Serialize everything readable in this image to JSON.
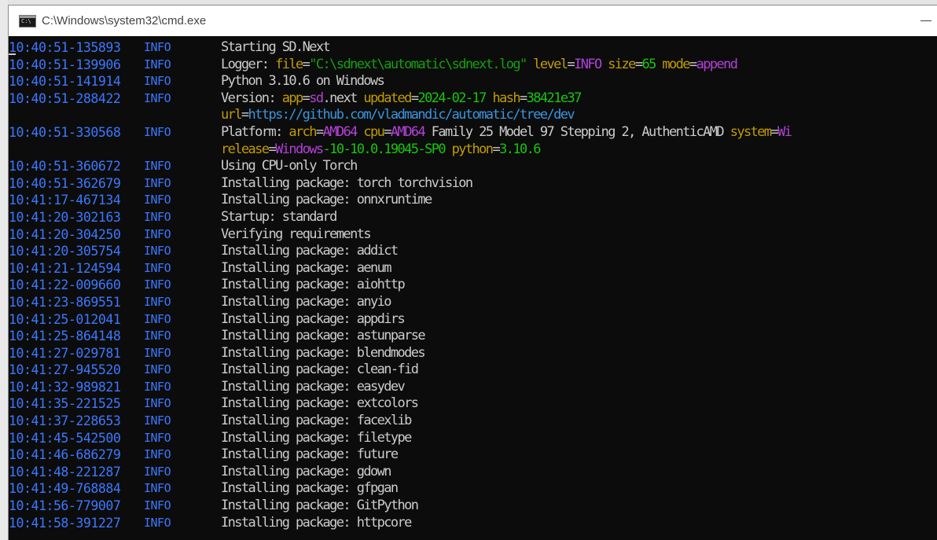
{
  "window": {
    "title": "C:\\Windows\\system32\\cmd.exe",
    "icon_label": "C:\\"
  },
  "colors": {
    "timestamp": "#3b78ff",
    "text": "#cccccc",
    "key": "#c19c00",
    "string": "#13a10e",
    "magenta": "#b340d8",
    "number": "#16c60c",
    "background": "#0c0c0c"
  },
  "log": [
    {
      "ts": "10:40:51-135893",
      "lvl": "INFO",
      "msg": "Starting SD.Next"
    },
    {
      "ts": "10:40:51-139906",
      "lvl": "INFO",
      "msg": "Logger: file=\"C:\\sdnext\\automatic\\sdnext.log\" level=INFO size=65 mode=append"
    },
    {
      "ts": "10:40:51-141914",
      "lvl": "INFO",
      "msg": "Python 3.10.6 on Windows"
    },
    {
      "ts": "10:40:51-288422",
      "lvl": "INFO",
      "msg": "Version: app=sd.next updated=2024-02-17 hash=38421e37"
    },
    {
      "ts": "",
      "lvl": "",
      "msg": "url=https://github.com/vladmandic/automatic/tree/dev"
    },
    {
      "ts": "10:40:51-330568",
      "lvl": "INFO",
      "msg": "Platform: arch=AMD64 cpu=AMD64 Family 25 Model 97 Stepping 2, AuthenticAMD system=Wi"
    },
    {
      "ts": "",
      "lvl": "",
      "msg": "release=Windows-10-10.0.19045-SP0 python=3.10.6"
    },
    {
      "ts": "10:40:51-360672",
      "lvl": "INFO",
      "msg": "Using CPU-only Torch"
    },
    {
      "ts": "10:40:51-362679",
      "lvl": "INFO",
      "msg": "Installing package: torch torchvision"
    },
    {
      "ts": "10:41:17-467134",
      "lvl": "INFO",
      "msg": "Installing package: onnxruntime"
    },
    {
      "ts": "10:41:20-302163",
      "lvl": "INFO",
      "msg": "Startup: standard"
    },
    {
      "ts": "10:41:20-304250",
      "lvl": "INFO",
      "msg": "Verifying requirements"
    },
    {
      "ts": "10:41:20-305754",
      "lvl": "INFO",
      "msg": "Installing package: addict"
    },
    {
      "ts": "10:41:21-124594",
      "lvl": "INFO",
      "msg": "Installing package: aenum"
    },
    {
      "ts": "10:41:22-009660",
      "lvl": "INFO",
      "msg": "Installing package: aiohttp"
    },
    {
      "ts": "10:41:23-869551",
      "lvl": "INFO",
      "msg": "Installing package: anyio"
    },
    {
      "ts": "10:41:25-012041",
      "lvl": "INFO",
      "msg": "Installing package: appdirs"
    },
    {
      "ts": "10:41:25-864148",
      "lvl": "INFO",
      "msg": "Installing package: astunparse"
    },
    {
      "ts": "10:41:27-029781",
      "lvl": "INFO",
      "msg": "Installing package: blendmodes"
    },
    {
      "ts": "10:41:27-945520",
      "lvl": "INFO",
      "msg": "Installing package: clean-fid"
    },
    {
      "ts": "10:41:32-989821",
      "lvl": "INFO",
      "msg": "Installing package: easydev"
    },
    {
      "ts": "10:41:35-221525",
      "lvl": "INFO",
      "msg": "Installing package: extcolors"
    },
    {
      "ts": "10:41:37-228653",
      "lvl": "INFO",
      "msg": "Installing package: facexlib"
    },
    {
      "ts": "10:41:45-542500",
      "lvl": "INFO",
      "msg": "Installing package: filetype"
    },
    {
      "ts": "10:41:46-686279",
      "lvl": "INFO",
      "msg": "Installing package: future"
    },
    {
      "ts": "10:41:48-221287",
      "lvl": "INFO",
      "msg": "Installing package: gdown"
    },
    {
      "ts": "10:41:49-768884",
      "lvl": "INFO",
      "msg": "Installing package: gfpgan"
    },
    {
      "ts": "10:41:56-779007",
      "lvl": "INFO",
      "msg": "Installing package: GitPython"
    },
    {
      "ts": "10:41:58-391227",
      "lvl": "INFO",
      "msg": "Installing package: httpcore"
    }
  ]
}
